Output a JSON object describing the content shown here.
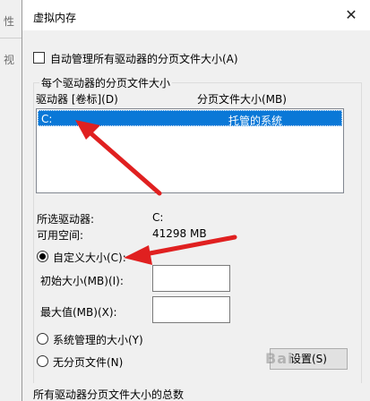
{
  "background": {
    "tab_text_1": "性",
    "tab_text_2": "视"
  },
  "dialog": {
    "title": "虚拟内存",
    "auto_manage_label": "自动管理所有驱动器的分页文件大小(A)",
    "group_title": "每个驱动器的分页文件大小",
    "columns": {
      "drive": "驱动器 [卷标](D)",
      "paging": "分页文件大小(MB)"
    },
    "rows": [
      {
        "drive": "C:",
        "paging": "托管的系统"
      }
    ],
    "selected_drive_label": "所选驱动器:",
    "selected_drive_value": "C:",
    "available_space_label": "可用空间:",
    "available_space_value": "41298 MB",
    "custom_size_label": "自定义大小(C):",
    "initial_size_label": "初始大小(MB)(I):",
    "initial_size_value": "",
    "max_size_label": "最大值(MB)(X):",
    "max_size_value": "",
    "system_managed_label": "系统管理的大小(Y)",
    "no_paging_label": "无分页文件(N)",
    "set_button": "设置(S)",
    "total_section_label": "所有驱动器分页文件大小的总数"
  },
  "watermark": "Bai",
  "colors": {
    "selection": "#0a78d7",
    "annotation_arrow": "#e02020"
  }
}
